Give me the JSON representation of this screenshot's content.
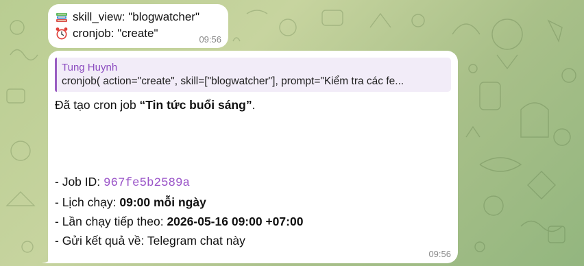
{
  "messages": [
    {
      "lines": [
        {
          "emoji": "books-icon",
          "text": "skill_view: \"blogwatcher\""
        },
        {
          "emoji": "alarm-clock-icon",
          "text": "cronjob: \"create\""
        }
      ],
      "time": "09:56"
    },
    {
      "reply": {
        "author": "Tung Huynh",
        "text": "cronjob( action=\"create\", skill=[\"blogwatcher\"], prompt=\"Kiểm tra các fe..."
      },
      "created_prefix": "Đã tạo cron job ",
      "created_name": "“Tin tức buổi sáng”",
      "created_suffix": ".",
      "job_id_label": "- Job ID: ",
      "job_id": "967fe5b2589a",
      "schedule_label": "- Lịch chạy: ",
      "schedule": "09:00 mỗi ngày",
      "next_run_label": "- Lần chạy tiếp theo: ",
      "next_run": "2026-05-16 09:00 +07:00",
      "deliver_text": "- Gửi kết quả về: Telegram chat này",
      "time": "09:56"
    }
  ],
  "colors": {
    "accent": "#9a54c8",
    "reply_bar": "#9a5dc2",
    "reply_bg": "#f2ecf8",
    "bubble": "#ffffff"
  }
}
